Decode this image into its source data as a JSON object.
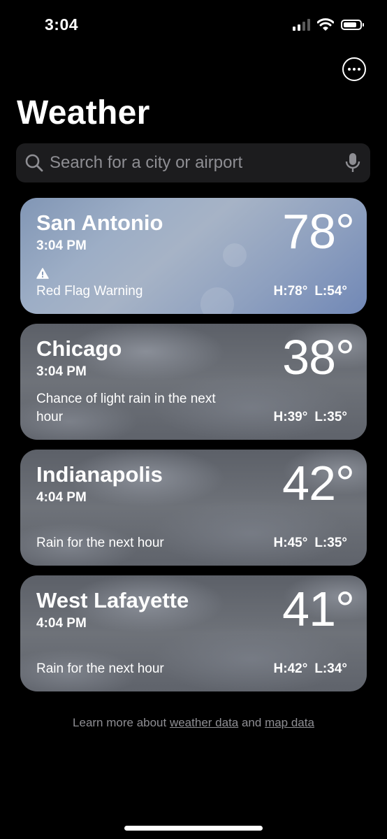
{
  "status_bar": {
    "time": "3:04",
    "icons": [
      "signal-icon",
      "wifi-icon",
      "battery-icon"
    ]
  },
  "header": {
    "title": "Weather",
    "more_icon": "ellipsis-circle-icon"
  },
  "search": {
    "placeholder": "Search for a city or airport",
    "value": "",
    "icons": [
      "search-icon",
      "microphone-icon"
    ]
  },
  "cities": [
    {
      "name": "San Antonio",
      "time": "3:04 PM",
      "temp": "78°",
      "alert_icon": "warning-icon",
      "condition": "Red Flag Warning",
      "high": "H:78°",
      "low": "L:54°"
    },
    {
      "name": "Chicago",
      "time": "3:04 PM",
      "temp": "38°",
      "condition": "Chance of light rain in the next hour",
      "high": "H:39°",
      "low": "L:35°"
    },
    {
      "name": "Indianapolis",
      "time": "4:04 PM",
      "temp": "42°",
      "condition": "Rain for the next hour",
      "high": "H:45°",
      "low": "L:35°"
    },
    {
      "name": "West Lafayette",
      "time": "4:04 PM",
      "temp": "41°",
      "condition": "Rain for the next hour",
      "high": "H:42°",
      "low": "L:34°"
    }
  ],
  "footer": {
    "prefix": "Learn more about ",
    "weather_link": "weather data",
    "middle": " and ",
    "map_link": "map data"
  }
}
